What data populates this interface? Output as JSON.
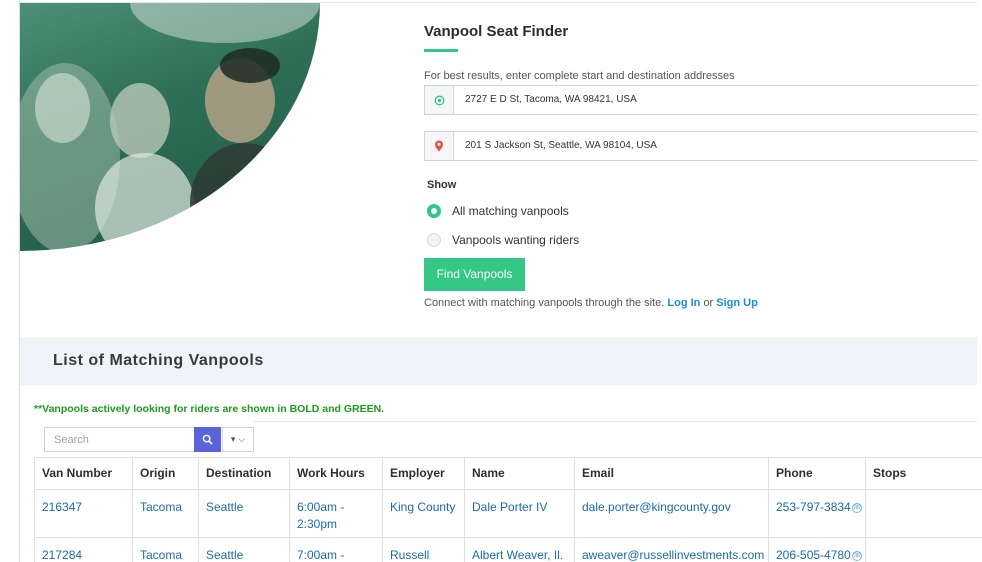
{
  "finder": {
    "title": "Vanpool Seat Finder",
    "hint": "For best results, enter complete start and destination addresses",
    "start_address": "2727 E D St, Tacoma, WA 98421, USA",
    "destination_address": "201 S Jackson St, Seattle, WA 98104, USA",
    "show_label": "Show",
    "options": [
      {
        "label": "All matching vanpools",
        "selected": true
      },
      {
        "label": "Vanpools wanting riders",
        "selected": false
      }
    ],
    "find_button": "Find Vanpools",
    "connect_text": "Connect with matching vanpools through the site.",
    "login_label": "Log In",
    "or_text": "or",
    "signup_label": "Sign Up"
  },
  "list": {
    "title": "List of Matching Vanpools",
    "note": "**Vanpools actively looking for riders are shown in BOLD and GREEN.",
    "search_placeholder": "Search",
    "columns": [
      "Van Number",
      "Origin",
      "Destination",
      "Work Hours",
      "Employer",
      "Name",
      "Email",
      "Phone",
      "Stops"
    ],
    "rows": [
      {
        "van": "216347",
        "origin": "Tacoma",
        "destination": "Seattle",
        "hours_1": "6:00am -",
        "hours_2": "2:30pm",
        "employer": "King County",
        "name": "Dale Porter IV",
        "email": "dale.porter@kingcounty.gov",
        "phone": "253-797-3834",
        "stops": ""
      },
      {
        "van": "217284",
        "origin": "Tacoma",
        "destination": "Seattle",
        "hours_1": "7:00am -",
        "hours_2": "",
        "employer": "Russell",
        "name": "Albert Weaver, Il.",
        "email": "aweaver@russellinvestments.com",
        "phone": "206-505-4780",
        "stops": ""
      }
    ]
  },
  "colors": {
    "accent_green": "#34c786",
    "link_blue": "#1a8ed8",
    "search_button": "#5a63d8",
    "note_green": "#1f9a1f"
  },
  "icons": {
    "start": "target-icon",
    "destination": "map-pin-icon",
    "search": "search-icon",
    "column_toggle": "chevron-down-icon",
    "phone": "phone-icon"
  }
}
